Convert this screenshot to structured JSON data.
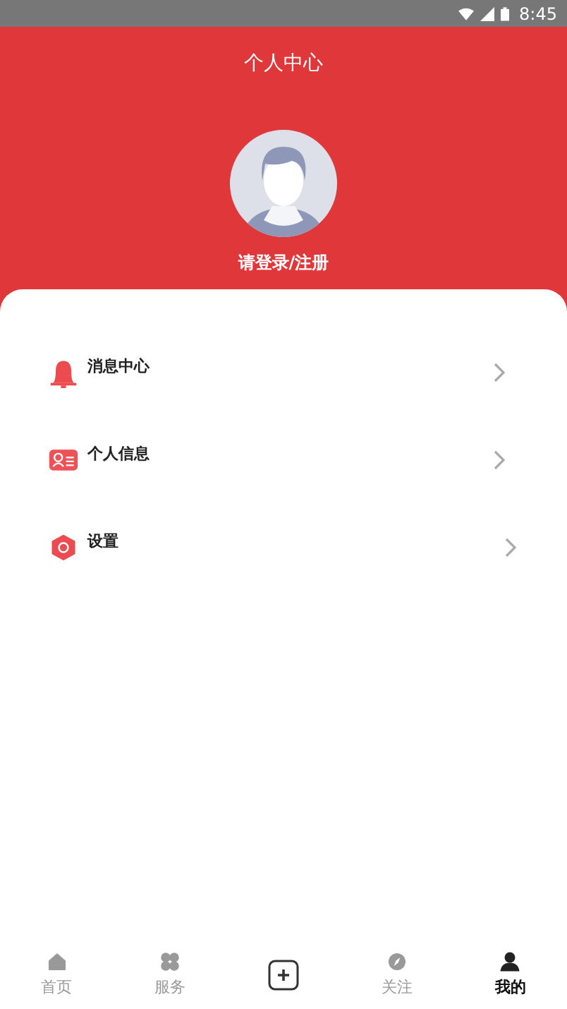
{
  "status_bar": {
    "time": "8:45"
  },
  "header": {
    "title": "个人中心",
    "login_text": "请登录/注册"
  },
  "menu": [
    {
      "kind": "bell",
      "label": "消息中心"
    },
    {
      "kind": "card",
      "label": "个人信息"
    },
    {
      "kind": "hex",
      "label": "设置"
    }
  ],
  "tab_bar": [
    {
      "kind": "home",
      "label": "首页",
      "selected": false
    },
    {
      "kind": "grid",
      "label": "服务",
      "selected": false
    },
    {
      "kind": "plus",
      "selected": false
    },
    {
      "kind": "compass",
      "label": "关注",
      "selected": false
    },
    {
      "kind": "person",
      "label": "我的",
      "selected": true
    }
  ]
}
